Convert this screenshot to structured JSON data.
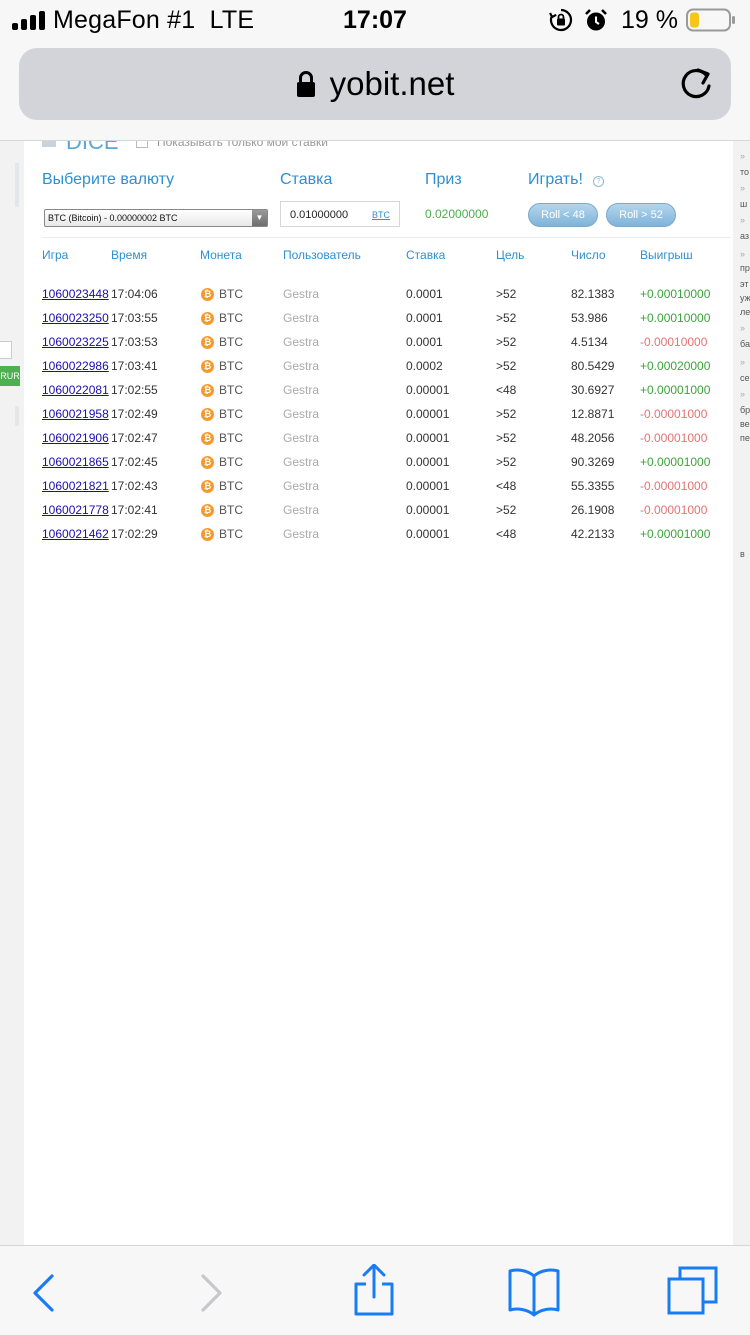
{
  "status_bar": {
    "carrier": "MegaFon #1",
    "network": "LTE",
    "time": "17:07",
    "battery_percent": "19 %"
  },
  "browser": {
    "url": "yobit.net"
  },
  "dice": {
    "title": "DICE",
    "only_mine_label": "Показывать только мои ставки",
    "currency_label": "Выберите валюту",
    "currency_selected": "BTC (Bitcoin) - 0.00000002 BTC",
    "bet_label": "Ставка",
    "bet_value": "0.01000000",
    "bet_currency": "BTC",
    "prize_label": "Приз",
    "prize_value": "0.02000000",
    "play_label": "Играть!",
    "roll_under_label": "Roll < 48",
    "roll_over_label": "Roll > 52"
  },
  "table": {
    "headers": {
      "game": "Игра",
      "time": "Время",
      "coin": "Монета",
      "user": "Пользователь",
      "bet": "Ставка",
      "target": "Цель",
      "number": "Число",
      "win": "Выигрыш"
    },
    "rows": [
      {
        "game": "1060023448",
        "time": "17:04:06",
        "coin": "BTC",
        "user": "Gestra",
        "bet": "0.0001",
        "target": ">52",
        "number": "82.1383",
        "win": "+0.00010000",
        "win_positive": true
      },
      {
        "game": "1060023250",
        "time": "17:03:55",
        "coin": "BTC",
        "user": "Gestra",
        "bet": "0.0001",
        "target": ">52",
        "number": "53.986",
        "win": "+0.00010000",
        "win_positive": true
      },
      {
        "game": "1060023225",
        "time": "17:03:53",
        "coin": "BTC",
        "user": "Gestra",
        "bet": "0.0001",
        "target": ">52",
        "number": "4.5134",
        "win": "-0.00010000",
        "win_positive": false
      },
      {
        "game": "1060022986",
        "time": "17:03:41",
        "coin": "BTC",
        "user": "Gestra",
        "bet": "0.0002",
        "target": ">52",
        "number": "80.5429",
        "win": "+0.00020000",
        "win_positive": true
      },
      {
        "game": "1060022081",
        "time": "17:02:55",
        "coin": "BTC",
        "user": "Gestra",
        "bet": "0.00001",
        "target": "<48",
        "number": "30.6927",
        "win": "+0.00001000",
        "win_positive": true
      },
      {
        "game": "1060021958",
        "time": "17:02:49",
        "coin": "BTC",
        "user": "Gestra",
        "bet": "0.00001",
        "target": ">52",
        "number": "12.8871",
        "win": "-0.00001000",
        "win_positive": false
      },
      {
        "game": "1060021906",
        "time": "17:02:47",
        "coin": "BTC",
        "user": "Gestra",
        "bet": "0.00001",
        "target": ">52",
        "number": "48.2056",
        "win": "-0.00001000",
        "win_positive": false
      },
      {
        "game": "1060021865",
        "time": "17:02:45",
        "coin": "BTC",
        "user": "Gestra",
        "bet": "0.00001",
        "target": ">52",
        "number": "90.3269",
        "win": "+0.00001000",
        "win_positive": true
      },
      {
        "game": "1060021821",
        "time": "17:02:43",
        "coin": "BTC",
        "user": "Gestra",
        "bet": "0.00001",
        "target": "<48",
        "number": "55.3355",
        "win": "-0.00001000",
        "win_positive": false
      },
      {
        "game": "1060021778",
        "time": "17:02:41",
        "coin": "BTC",
        "user": "Gestra",
        "bet": "0.00001",
        "target": ">52",
        "number": "26.1908",
        "win": "-0.00001000",
        "win_positive": false
      },
      {
        "game": "1060021462",
        "time": "17:02:29",
        "coin": "BTC",
        "user": "Gestra",
        "bet": "0.00001",
        "target": "<48",
        "number": "42.2133",
        "win": "+0.00001000",
        "win_positive": true
      }
    ]
  },
  "left_strip": {
    "badge": "RUR"
  },
  "right_strip": {
    "fragments": [
      "то",
      "ш",
      "аз",
      "пр",
      "эт",
      "уж",
      "ле",
      "ба",
      "се",
      "бр",
      "ве",
      "пе",
      "в"
    ]
  },
  "colors": {
    "accent": "#2f8fd0",
    "positive": "#3aa53a",
    "negative": "#e57373",
    "coin": "#f39a2b",
    "ios_blue": "#1a7cf5"
  },
  "icons": {
    "lock": "lock-icon",
    "reload": "reload-icon",
    "back": "back-chevron-icon",
    "forward": "forward-chevron-icon",
    "share": "share-icon",
    "bookmarks": "bookmarks-icon",
    "tabs": "tabs-icon",
    "bitcoin": "bitcoin-icon"
  }
}
